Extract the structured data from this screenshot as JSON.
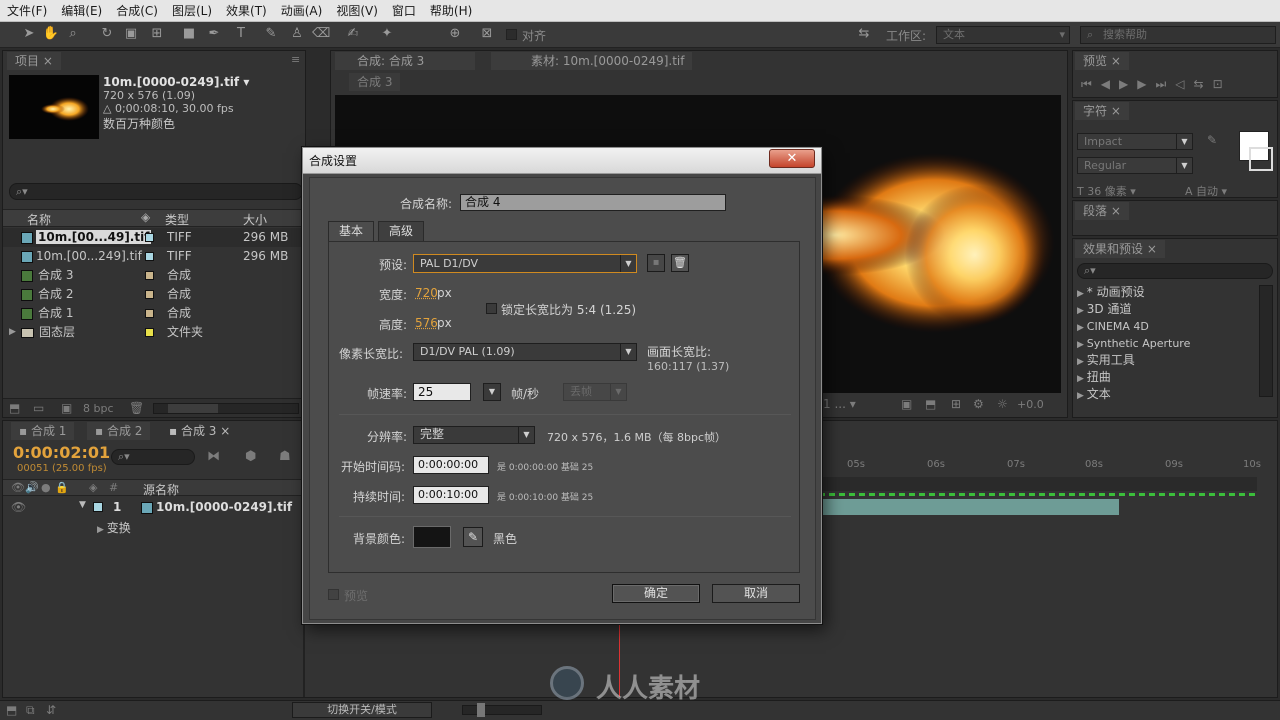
{
  "menu": [
    "文件(F)",
    "编辑(E)",
    "合成(C)",
    "图层(L)",
    "效果(T)",
    "动画(A)",
    "视图(V)",
    "窗口",
    "帮助(H)"
  ],
  "toolbar": {
    "align_label": "对齐",
    "workspace_label": "工作区:",
    "workspace_value": "文本",
    "search_placeholder": "搜索帮助"
  },
  "project": {
    "tab": "项目",
    "file_name": "10m.[0000-0249].tif ▾",
    "dimensions": "720 x 576 (1.09)",
    "duration": "△ 0;00:08:10, 30.00 fps",
    "colors": "数百万种颜色",
    "search_icon": "⌕▾",
    "columns": {
      "name": "名称",
      "type": "类型",
      "size": "大小"
    },
    "items": [
      {
        "name": "10m.[00...49].tif",
        "type": "TIFF",
        "size": "296 MB",
        "kind": "file",
        "color": "#a9d6e2"
      },
      {
        "name": "10m.[00...249].tif",
        "type": "TIFF",
        "size": "296 MB",
        "kind": "file",
        "color": "#a9d6e2"
      },
      {
        "name": "合成 3",
        "type": "合成",
        "size": "",
        "kind": "comp",
        "color": "#c9b48b"
      },
      {
        "name": "合成 2",
        "type": "合成",
        "size": "",
        "kind": "comp",
        "color": "#c9b48b"
      },
      {
        "name": "合成 1",
        "type": "合成",
        "size": "",
        "kind": "comp",
        "color": "#c9b48b"
      },
      {
        "name": "固态层",
        "type": "文件夹",
        "size": "",
        "kind": "folder",
        "color": "#e8e04a"
      }
    ],
    "bpc": "8 bpc"
  },
  "viewer": {
    "tab1": "合成: 合成 3",
    "tab2": "素材: 10m.[0000-0249].tif",
    "subtab": "合成 3",
    "exposure": "+0.0",
    "zoom": "1 ..."
  },
  "right_panels": {
    "preview": "预览",
    "character": "字符",
    "font": "Impact",
    "style": "Regular",
    "font_size": "36 像素",
    "leading": "自动",
    "paragraph": "段落",
    "effects": "效果和预设",
    "effects_items": [
      "* 动画预设",
      "3D 通道",
      "CINEMA 4D",
      "Synthetic Aperture",
      "实用工具",
      "扭曲",
      "文本"
    ]
  },
  "timeline": {
    "tabs": [
      "合成 1",
      "合成 2",
      "合成 3"
    ],
    "timecode": "0:00:02:01",
    "frame_info": "00051 (25.00 fps)",
    "col_source": "源名称",
    "layer_num": "1",
    "layer_name": "10m.[0000-0249].tif",
    "transform": "变换",
    "ruler": [
      "05s",
      "06s",
      "07s",
      "08s",
      "09s",
      "10s"
    ],
    "toggle_label": "切换开关/模式"
  },
  "dialog": {
    "title": "合成设置",
    "name_label": "合成名称:",
    "name_value": "合成 4",
    "tab_basic": "基本",
    "tab_advanced": "高级",
    "preset_label": "预设:",
    "preset_value": "PAL D1/DV",
    "width_label": "宽度:",
    "width_value": "720",
    "height_label": "高度:",
    "height_value": "576",
    "px": "px",
    "lock_label": "锁定长宽比为 5:4 (1.25)",
    "pixel_aspect_label": "像素长宽比:",
    "pixel_aspect_value": "D1/DV PAL (1.09)",
    "frame_aspect_label": "画面长宽比:",
    "frame_aspect_value": "160:117 (1.37)",
    "fps_label": "帧速率:",
    "fps_value": "25",
    "fps_unit": "帧/秒",
    "drop_frame": "丢帧",
    "res_label": "分辨率:",
    "res_value": "完整",
    "res_info": "720 x 576，1.6 MB（每 8bpc帧）",
    "start_label": "开始时间码:",
    "start_value": "0:00:00:00",
    "start_info": "是 0:00:00:00  基础 25",
    "dur_label": "持续时间:",
    "dur_value": "0:00:10:00",
    "dur_info": "是 0:00:10:00  基础 25",
    "bg_label": "背景颜色:",
    "bg_color": "#141414",
    "bg_name": "黑色",
    "preview_label": "预览",
    "ok": "确定",
    "cancel": "取消",
    "close": "✕"
  },
  "watermark": "人人素材"
}
